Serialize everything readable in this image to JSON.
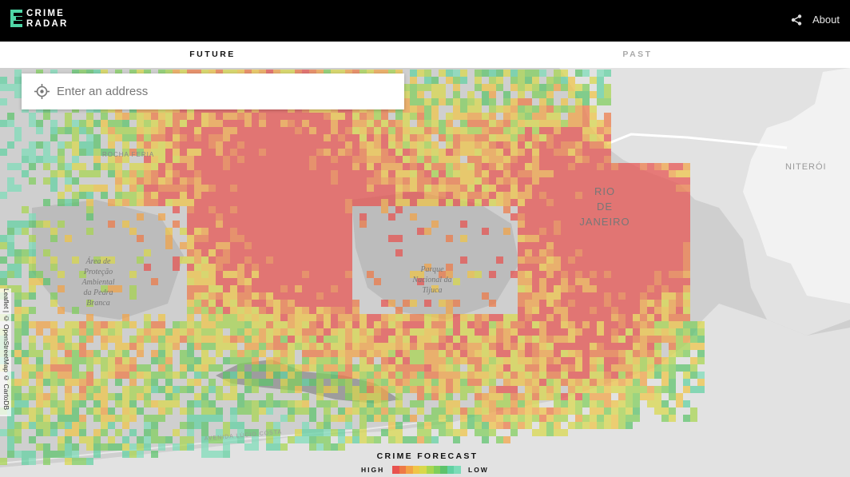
{
  "header": {
    "logo_line1": "CRIME",
    "logo_line2": "RADAR",
    "about_label": "About",
    "share_icon": "share-icon"
  },
  "tabs": [
    {
      "label": "FUTURE",
      "active": true
    },
    {
      "label": "PAST",
      "active": false
    }
  ],
  "search": {
    "placeholder": "Enter an address",
    "value": "",
    "icon": "crosshair-icon"
  },
  "map": {
    "labels": {
      "bairro": "ROCHA FERIA",
      "niteroi": "NITERÓI",
      "rio": [
        "RIO",
        "DE",
        "JANEIRO"
      ],
      "pedra_branca": [
        "Área de",
        "Proteção",
        "Ambiental",
        "da Pedra",
        "Branca"
      ],
      "tijuca": [
        "Parque",
        "Nacional da",
        "Tijuca"
      ],
      "avenida": "AVENIDA LÚCIO COSTA"
    },
    "colors": {
      "land": "#cfcfcf",
      "dark_land": "#b8b8b8",
      "water": "#e2e2e2",
      "roads": "#ffffff"
    }
  },
  "attribution": "Leaflet | © OpenStreetMap © CartoDB",
  "legend": {
    "title": "CRIME FORECAST",
    "high_label": "HIGH",
    "low_label": "LOW",
    "colors": [
      "#e8524f",
      "#ee7a46",
      "#f2a346",
      "#f0c547",
      "#d9d84b",
      "#a8d64f",
      "#7fcf5b",
      "#5cc36b",
      "#61d1a2",
      "#7ddcb8"
    ]
  }
}
